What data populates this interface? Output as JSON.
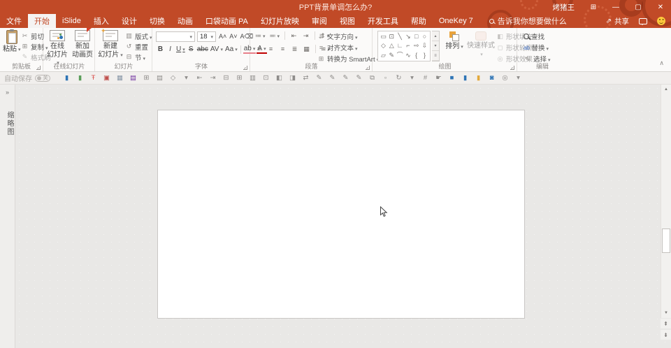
{
  "window": {
    "title": "PPT背景单调怎么办?",
    "user": "烤猪王",
    "controls": {
      "ribbon_display": "⊞",
      "minimize": "—",
      "maximize": "▢",
      "close": "✕"
    }
  },
  "tabs": {
    "file": "文件",
    "selected": "开始",
    "items": [
      "开始",
      "iSlide",
      "插入",
      "设计",
      "切换",
      "动画",
      "口袋动画 PA",
      "幻灯片放映",
      "审阅",
      "视图",
      "开发工具",
      "帮助",
      "OneKey 7"
    ],
    "tell_me": "告诉我你想要做什么",
    "share": "共享"
  },
  "ribbon": {
    "clipboard": {
      "group": "剪贴板",
      "paste": "粘贴",
      "small": [
        {
          "name": "cut",
          "icon": "✂",
          "label": "剪切"
        },
        {
          "name": "copy",
          "icon": "⊞",
          "label": "复制",
          "dd": true
        },
        {
          "name": "format-painter",
          "icon": "✎",
          "label": "格式刷",
          "dim": true
        }
      ]
    },
    "online": {
      "group": "在线幻灯片",
      "btn1_l1": "在线",
      "btn1_l2": "幻灯片",
      "btn2_l1": "新加",
      "btn2_l2": "动画页"
    },
    "slides": {
      "group": "幻灯片",
      "new_l1": "新建",
      "new_l2": "幻灯片",
      "small": [
        {
          "name": "layout",
          "icon": "▥",
          "label": "版式",
          "dd": true
        },
        {
          "name": "reset",
          "icon": "↺",
          "label": "重置"
        },
        {
          "name": "section",
          "icon": "⊟",
          "label": "节",
          "dd": true
        }
      ]
    },
    "font": {
      "group": "字体",
      "size": "18",
      "row1_extra": [
        {
          "name": "grow-font",
          "glyph": "A˄"
        },
        {
          "name": "shrink-font",
          "glyph": "A˅"
        },
        {
          "name": "clear-formatting",
          "glyph": "A⌫"
        }
      ],
      "row2": [
        {
          "name": "bold",
          "glyph": "B",
          "cls": "b"
        },
        {
          "name": "italic",
          "glyph": "I",
          "cls": "i"
        },
        {
          "name": "underline",
          "glyph": "U",
          "cls": "u",
          "dd": true
        },
        {
          "name": "strikethrough",
          "glyph": "S",
          "cls": "s"
        },
        {
          "name": "abc-strike",
          "glyph": "abc",
          "cls": "s"
        },
        {
          "name": "character-spacing",
          "glyph": "AV",
          "dd": true
        },
        {
          "name": "change-case",
          "glyph": "Aa",
          "dd": true
        },
        {
          "sep": true
        },
        {
          "name": "text-highlight",
          "glyph": "ab",
          "bar": "hl",
          "dd": true
        },
        {
          "name": "font-color",
          "glyph": "A",
          "bar": "color",
          "dd": true
        }
      ]
    },
    "paragraph": {
      "group": "段落",
      "row1": [
        {
          "name": "bullets",
          "glyph": "≔",
          "dd": true
        },
        {
          "name": "numbering",
          "glyph": "≕",
          "dd": true
        },
        {
          "sep": true
        },
        {
          "name": "decrease-indent",
          "glyph": "⇤"
        },
        {
          "name": "increase-indent",
          "glyph": "⇥"
        },
        {
          "sep": true
        },
        {
          "name": "line-spacing",
          "glyph": "⇕",
          "dd": true
        }
      ],
      "row2": [
        {
          "name": "align-left",
          "glyph": "≡"
        },
        {
          "name": "align-center",
          "glyph": "≡"
        },
        {
          "name": "align-right",
          "glyph": "≡"
        },
        {
          "name": "justify",
          "glyph": "≣"
        },
        {
          "name": "distribute",
          "glyph": "▦"
        },
        {
          "sep": true
        },
        {
          "name": "columns",
          "glyph": "≋",
          "dd": true
        }
      ],
      "text_col": [
        {
          "name": "text-direction",
          "icon": "⇵",
          "label": "文字方向",
          "dd": true
        },
        {
          "name": "align-text",
          "icon": "≡",
          "label": "对齐文本",
          "dd": true
        },
        {
          "name": "convert-smartart",
          "icon": "⊞",
          "label": "转换为 SmartArt",
          "dd": true
        }
      ]
    },
    "drawing": {
      "group": "绘图",
      "arrange": "排列",
      "quick_styles": "快速样式",
      "shape_rows": [
        [
          "▭",
          "⊡",
          "╲",
          "↘",
          "□",
          "○"
        ],
        [
          "◇",
          "△",
          "∟",
          "⌐",
          "⇨",
          "⇩"
        ],
        [
          "▱",
          "✎",
          "⌒",
          "∿",
          "{",
          "}"
        ]
      ],
      "scroll": [
        "▴",
        "▾",
        "≡"
      ]
    },
    "shape_format": [
      {
        "name": "shape-fill",
        "icon": "◧",
        "label": "形状填充",
        "dd": true
      },
      {
        "name": "shape-outline",
        "icon": "◻",
        "label": "形状轮廓",
        "dd": true
      },
      {
        "name": "shape-effects",
        "icon": "◎",
        "label": "形状效果",
        "dd": true
      }
    ],
    "editing": {
      "group": "编辑",
      "items": [
        {
          "name": "find",
          "icon": "mag",
          "label": "查找"
        },
        {
          "name": "replace",
          "icon": "ab",
          "label": "替换",
          "dd": true
        },
        {
          "name": "select",
          "icon": "⇖",
          "label": "选择",
          "dd": true
        }
      ]
    }
  },
  "qat": {
    "autosave": "自动保存",
    "autosave_state": "关",
    "icons": [
      {
        "name": "placeholder-blue",
        "glyph": "▮",
        "color": "#2e74b5"
      },
      {
        "name": "placeholder-green",
        "glyph": "▮",
        "color": "#5a9e5a"
      },
      {
        "name": "align-middle-red",
        "glyph": "Ŧ",
        "color": "#d9534f"
      },
      {
        "name": "red-border-box",
        "glyph": "▣",
        "color": "#c0504d"
      },
      {
        "name": "table-box",
        "glyph": "▦",
        "color": "#8a98a8"
      },
      {
        "name": "save",
        "glyph": "▤",
        "color": "#7030a0"
      },
      {
        "name": "slide-edit",
        "glyph": "⊞",
        "color": "#8e8c8a"
      },
      {
        "name": "slide-layout",
        "glyph": "▤",
        "color": "#8e8c8a"
      },
      {
        "name": "shape-insert",
        "glyph": "◇",
        "color": "#8e8c8a"
      },
      {
        "name": "dropdown",
        "glyph": "▾",
        "color": "#8e8c8a"
      },
      {
        "name": "align-left-objects",
        "glyph": "⇤",
        "color": "#8e8c8a"
      },
      {
        "name": "align-right-objects",
        "glyph": "⇥",
        "color": "#8e8c8a"
      },
      {
        "name": "distribute-horizontal",
        "glyph": "⊟",
        "color": "#8e8c8a"
      },
      {
        "name": "distribute-vertical",
        "glyph": "⊞",
        "color": "#8e8c8a"
      },
      {
        "name": "chart",
        "glyph": "▥",
        "color": "#8e8c8a"
      },
      {
        "name": "print",
        "glyph": "⊡",
        "color": "#8e8c8a"
      },
      {
        "name": "flip-horizontal",
        "glyph": "◧",
        "color": "#8e8c8a"
      },
      {
        "name": "flip-vertical",
        "glyph": "◨",
        "color": "#8e8c8a"
      },
      {
        "name": "swap",
        "glyph": "⇄",
        "color": "#8e8c8a"
      },
      {
        "name": "pen-1",
        "glyph": "✎",
        "color": "#8e8c8a"
      },
      {
        "name": "pen-2",
        "glyph": "✎",
        "color": "#8e8c8a"
      },
      {
        "name": "pen-3",
        "glyph": "✎",
        "color": "#8e8c8a"
      },
      {
        "name": "pen-4",
        "glyph": "✎",
        "color": "#8e8c8a"
      },
      {
        "name": "copy-object",
        "glyph": "⧉",
        "color": "#8e8c8a"
      },
      {
        "name": "paste-object",
        "glyph": "▫",
        "color": "#8e8c8a"
      },
      {
        "name": "rotate",
        "glyph": "↻",
        "color": "#8e8c8a"
      },
      {
        "name": "rotate-dropdown",
        "glyph": "▾",
        "color": "#8e8c8a"
      },
      {
        "name": "grid",
        "glyph": "#",
        "color": "#8e8c8a"
      },
      {
        "name": "select-hand",
        "glyph": "☛",
        "color": "#8e8c8a"
      },
      {
        "name": "blue-square",
        "glyph": "■",
        "color": "#2e74b5"
      },
      {
        "name": "blue-bar",
        "glyph": "▮",
        "color": "#2e74b5"
      },
      {
        "name": "yellow-bar",
        "glyph": "▮",
        "color": "#e3a93c"
      },
      {
        "name": "lock",
        "glyph": "◙",
        "color": "#2e74b5"
      },
      {
        "name": "unlock",
        "glyph": "◎",
        "color": "#8e8c8a"
      },
      {
        "name": "more",
        "glyph": "▾",
        "color": "#8e8c8a"
      }
    ]
  },
  "left_panel": {
    "collapse": "»",
    "label": "缩略图"
  },
  "scrollbar": {
    "up": "▲",
    "down": "▼",
    "prev": "⇞",
    "next": "⇟"
  },
  "colors": {
    "accent": "#c14a27",
    "ribbon_bg": "#fbfaf9",
    "canvas_bg": "#e9e8e6"
  }
}
